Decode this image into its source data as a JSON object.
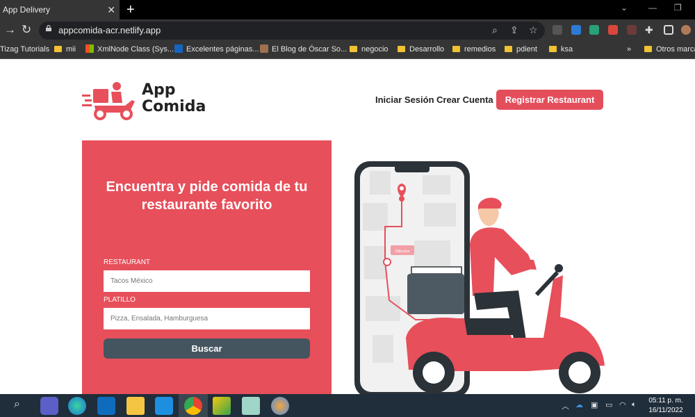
{
  "browser": {
    "tab_title": "App Delivery",
    "url": "appcomida-acr.netlify.app",
    "bookmarks": [
      {
        "label": "Tizag Tutorials",
        "icon": "none"
      },
      {
        "label": "mii",
        "icon": "folder"
      },
      {
        "label": "XmlNode Class (Sys...",
        "icon": "microsoft"
      },
      {
        "label": "Excelentes páginas...",
        "icon": "T"
      },
      {
        "label": "El Blog de Óscar So...",
        "icon": "avatar"
      },
      {
        "label": "negocio",
        "icon": "folder"
      },
      {
        "label": "Desarrollo",
        "icon": "folder"
      },
      {
        "label": "remedios",
        "icon": "folder"
      },
      {
        "label": "pdient",
        "icon": "folder"
      },
      {
        "label": "ksa",
        "icon": "folder"
      }
    ],
    "bookmarks_overflow": "»",
    "other_bookmarks": "Otros marca"
  },
  "site": {
    "brand_line1": "App",
    "brand_line2": "Comida",
    "nav": {
      "login": "Iniciar Sesión",
      "signup": "Crear Cuenta",
      "register_restaurant": "Registrar Restaurant"
    },
    "hero": {
      "title": "Encuentra y pide comida de tu restaurante favorito",
      "restaurant_label": "RESTAURANT",
      "restaurant_placeholder": "Tacos México",
      "dish_label": "PLATILLO",
      "dish_placeholder": "Pizza, Ensalada, Hamburguesa",
      "search_button": "Buscar"
    },
    "map_tag": "Objective"
  },
  "colors": {
    "accent": "#e74f5b",
    "button_dark": "#455560"
  },
  "taskbar": {
    "time": "05:11 p. m.",
    "date": "16/11/2022"
  }
}
